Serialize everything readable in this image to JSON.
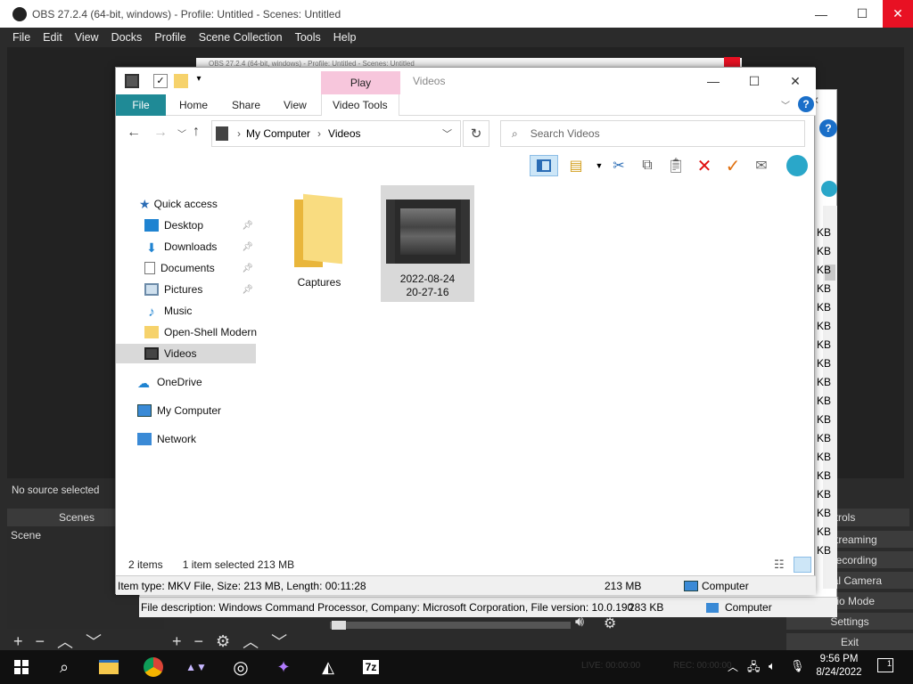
{
  "obs": {
    "title": "OBS 27.2.4 (64-bit, windows) - Profile: Untitled - Scenes: Untitled",
    "menu": [
      "File",
      "Edit",
      "View",
      "Docks",
      "Profile",
      "Scene Collection",
      "Tools",
      "Help"
    ],
    "inner_title": "OBS 27.2.4 (64-bit, windows) - Profile: Untitled - Scenes: Untitled",
    "no_source": "No source selected",
    "scenes_header": "Scenes",
    "scene_item": "Scene",
    "controls_header": "ntrols",
    "controls": [
      "t Streaming",
      "t Recording",
      "irtual Camera",
      "udio Mode",
      "Settings",
      "Exit"
    ],
    "live": "LIVE: 00:00:00",
    "rec": "REC: 00:00:00"
  },
  "explorer": {
    "play_tab": "Play",
    "title": "Videos",
    "ribbon_tabs": [
      "File",
      "Home",
      "Share",
      "View",
      "Video Tools"
    ],
    "breadcrumb": [
      "My Computer",
      "Videos"
    ],
    "search_placeholder": "Search Videos",
    "nav": {
      "quick_access": "Quick access",
      "items": [
        "Desktop",
        "Downloads",
        "Documents",
        "Pictures",
        "Music",
        "Open-Shell Modern",
        "Videos"
      ],
      "onedrive": "OneDrive",
      "my_computer": "My Computer",
      "network": "Network"
    },
    "files": [
      {
        "name": "Captures"
      },
      {
        "name_line1": "2022-08-24",
        "name_line2": "20-27-16"
      }
    ],
    "status": {
      "count": "2 items",
      "selected": "1 item selected  213 MB"
    },
    "info": {
      "desc": "Item type: MKV File, Size: 213 MB, Length: 00:11:28",
      "size": "213 MB",
      "location": "Computer"
    }
  },
  "bg_window": {
    "info_desc": "File description: Windows Command Processor, Company: Microsoft Corporation, File version: 10.0.190",
    "info_size": "283 KB",
    "info_location": "Computer",
    "kb_label": "KB"
  },
  "taskbar": {
    "time": "9:56 PM",
    "date": "8/24/2022",
    "notif_count": "1"
  }
}
